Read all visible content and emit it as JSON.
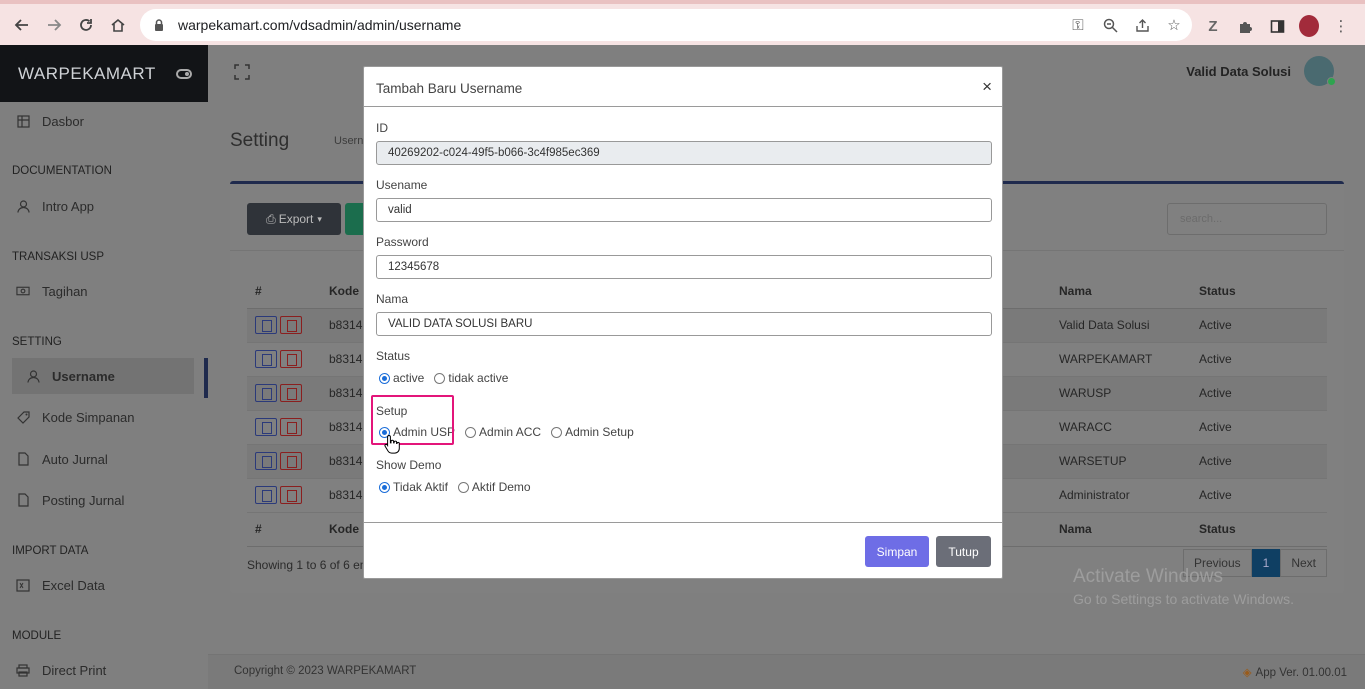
{
  "browser": {
    "url": "warpekamart.com/vdsadmin/admin/username"
  },
  "sidebar": {
    "brand": "WARPEKAMART",
    "items": [
      {
        "label": "Dasbor",
        "icon": "table-icon"
      },
      {
        "section": "DOCUMENTATION"
      },
      {
        "label": "Intro App",
        "icon": "user-icon"
      },
      {
        "section": "TRANSAKSI USP"
      },
      {
        "label": "Tagihan",
        "icon": "money-icon"
      },
      {
        "section": "SETTING"
      },
      {
        "label": "Username",
        "icon": "user-icon",
        "active": true
      },
      {
        "label": "Kode Simpanan",
        "icon": "tag-icon"
      },
      {
        "label": "Auto Jurnal",
        "icon": "file-icon"
      },
      {
        "label": "Posting Jurnal",
        "icon": "file-icon"
      },
      {
        "section": "IMPORT DATA"
      },
      {
        "label": "Excel Data",
        "icon": "excel-icon"
      },
      {
        "section": "MODULE"
      },
      {
        "label": "Direct Print",
        "icon": "print-icon"
      }
    ]
  },
  "topnav": {
    "user_name": "Valid Data Solusi"
  },
  "content": {
    "title": "Setting",
    "breadcrumb": "Userna",
    "export_label": "Export",
    "search_placeholder": "search...",
    "table": {
      "headers": [
        "#",
        "Kode",
        "Nama",
        "Status"
      ],
      "rows": [
        {
          "kode": "b8314",
          "nama": "Valid Data Solusi",
          "status": "Active"
        },
        {
          "kode": "b8314",
          "nama": "WARPEKAMART",
          "status": "Active"
        },
        {
          "kode": "b8314",
          "nama": "WARUSP",
          "status": "Active"
        },
        {
          "kode": "b8314",
          "nama": "WARACC",
          "status": "Active"
        },
        {
          "kode": "b8314",
          "nama": "WARSETUP",
          "status": "Active"
        },
        {
          "kode": "b8314",
          "nama": "Administrator",
          "status": "Active"
        }
      ]
    },
    "showing": "Showing 1 to 6 of 6 en",
    "pager": {
      "previous": "Previous",
      "current": "1",
      "next": "Next"
    }
  },
  "footer": {
    "copyright": "Copyright © 2023 WARPEKAMART",
    "version": "App Ver. 01.00.01"
  },
  "watermark": {
    "line1": "Activate Windows",
    "line2": "Go to Settings to activate Windows."
  },
  "modal": {
    "title": "Tambah Baru Username",
    "close": "×",
    "id_label": "ID",
    "id_value": "40269202-c024-49f5-b066-3c4f985ec369",
    "username_label": "Usename",
    "username_value": "valid",
    "password_label": "Password",
    "password_value": "12345678",
    "nama_label": "Nama",
    "nama_value": "VALID DATA SOLUSI BARU",
    "status_label": "Status",
    "status_options": [
      "active",
      "tidak active"
    ],
    "status_selected": "active",
    "setup_label": "Setup",
    "setup_options": [
      "Admin USP",
      "Admin ACC",
      "Admin Setup"
    ],
    "setup_selected": "Admin USP",
    "demo_label": "Show Demo",
    "demo_options": [
      "Tidak Aktif",
      "Aktif Demo"
    ],
    "demo_selected": "Tidak Aktif",
    "save_label": "Simpan",
    "close_label": "Tutup"
  },
  "colors": {
    "highlight": "#e3157a",
    "primary_button": "#6e6de6",
    "radio_selected": "#1a6dd9"
  }
}
